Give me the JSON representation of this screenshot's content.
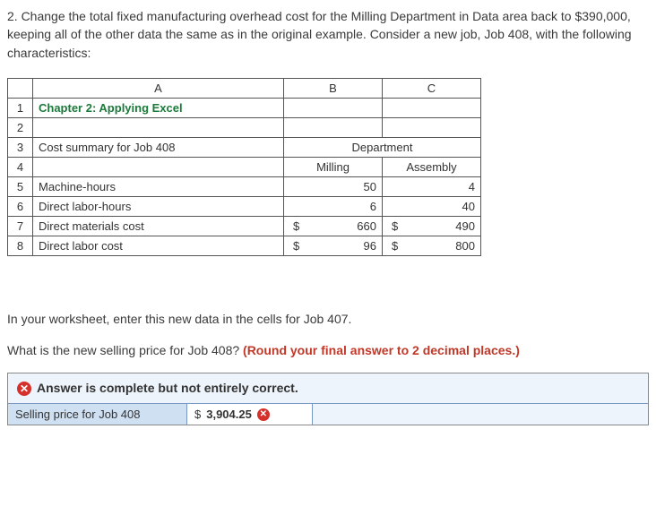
{
  "question": "2. Change the total fixed manufacturing overhead cost for the Milling Department in Data area back to $390,000, keeping all of the other data the same as in the original example. Consider a new job, Job 408, with the following characteristics:",
  "columns": {
    "a": "A",
    "b": "B",
    "c": "C"
  },
  "rows": {
    "r1": "1",
    "r2": "2",
    "r3": "3",
    "r4": "4",
    "r5": "5",
    "r6": "6",
    "r7": "7",
    "r8": "8"
  },
  "sheet": {
    "chapter_title": "Chapter 2: Applying Excel",
    "cost_summary_label": "Cost summary for Job 408",
    "department_label": "Department",
    "milling_label": "Milling",
    "assembly_label": "Assembly",
    "machine_hours_label": "Machine-hours",
    "machine_hours_milling": "50",
    "machine_hours_assembly": "4",
    "direct_labor_hours_label": "Direct labor-hours",
    "direct_labor_hours_milling": "6",
    "direct_labor_hours_assembly": "40",
    "direct_materials_label": "Direct materials cost",
    "direct_materials_milling": "660",
    "direct_materials_assembly": "490",
    "direct_labor_cost_label": "Direct labor cost",
    "direct_labor_cost_milling": "96",
    "direct_labor_cost_assembly": "800",
    "dollar": "$"
  },
  "instruction1": "In your worksheet, enter this new data in the cells for Job 407.",
  "instruction2_prefix": "What is the new selling price for Job 408? ",
  "instruction2_bold": "(Round your final answer to 2 decimal places.)",
  "feedback": {
    "header_text": "Answer is complete but not entirely correct.",
    "label": "Selling price for Job 408",
    "currency": "$",
    "value": "3,904.25"
  }
}
